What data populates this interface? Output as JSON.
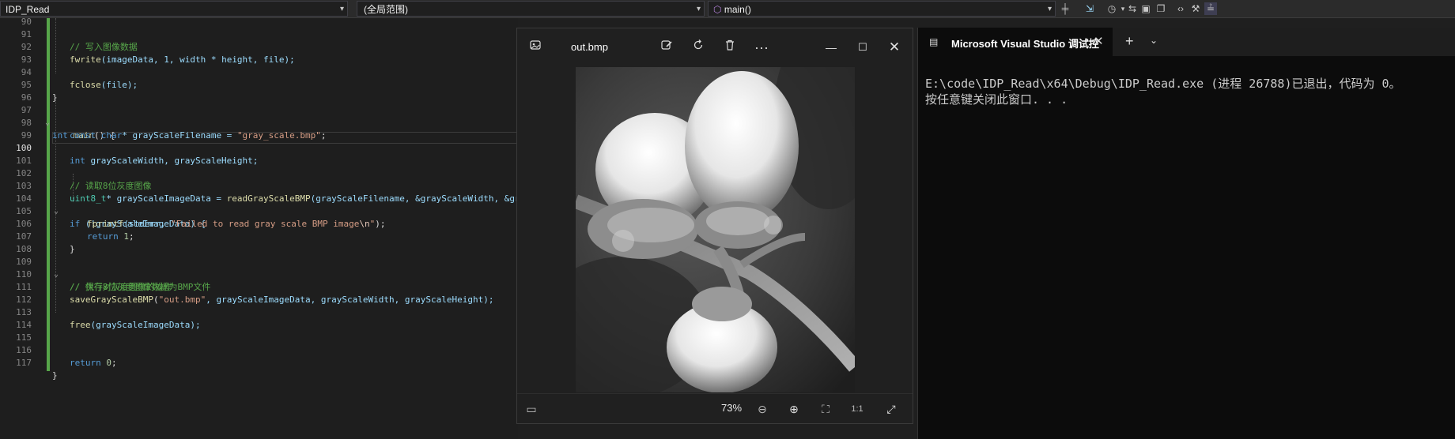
{
  "toolbar": {
    "project": "IDP_Read",
    "scope": "(全局范围)",
    "function": "main()"
  },
  "editor": {
    "current_line": 100,
    "lines": [
      {
        "num": 90
      },
      {
        "num": 91
      },
      {
        "num": 92
      },
      {
        "num": 93
      },
      {
        "num": 94
      },
      {
        "num": 95
      },
      {
        "num": 96
      },
      {
        "num": 97
      },
      {
        "num": 98
      },
      {
        "num": 99
      },
      {
        "num": 100
      },
      {
        "num": 101
      },
      {
        "num": 102
      },
      {
        "num": 103
      },
      {
        "num": 104
      },
      {
        "num": 105
      },
      {
        "num": 106
      },
      {
        "num": 107
      },
      {
        "num": 108
      },
      {
        "num": 109
      },
      {
        "num": 110
      },
      {
        "num": 111
      },
      {
        "num": 112
      },
      {
        "num": 113
      },
      {
        "num": 114
      },
      {
        "num": 115
      },
      {
        "num": 116
      },
      {
        "num": 117
      }
    ],
    "code": {
      "l91": "// 写入图像数据",
      "l92_fn": "fwrite",
      "l92_rest": "(imageData, 1, width * height, file);",
      "l94_fn": "fclose",
      "l94_rest": "(file);",
      "l95": "}",
      "l97_kw": "int",
      "l97_fn": "main",
      "l97_rest": "() {",
      "l98_kw": "const char",
      "l98_var": "* grayScaleFilename = ",
      "l98_str": "\"gray_scale.bmp\"",
      "l98_end": ";",
      "l100_kw": "int",
      "l100_rest": " grayScaleWidth, grayScaleHeight;",
      "l102": "// 读取8位灰度图像",
      "l103_ty": "uint8_t",
      "l103_var": "* grayScaleImageData = ",
      "l103_fn": "readGrayScaleBMP",
      "l103_rest": "(grayScaleFilename, &grayScaleWidth, &gr",
      "l104_kw": "if",
      "l104_rest": " (!grayScaleImageData) {",
      "l105_fn": "fprintf",
      "l105_a": "(stderr, ",
      "l105_str": "\"Failed to read gray scale BMP image",
      "l105_esc": "\\n",
      "l105_str2": "\"",
      "l105_end": ");",
      "l106_kw": "return",
      "l106_num": " 1",
      "l106_end": ";",
      "l107": "}",
      "l109": "// 执行对灰度图像的操作",
      "l110": "// 保存8位灰度图像数据为BMP文件",
      "l111_fn": "saveGrayScaleBMP",
      "l111_a": "(",
      "l111_str": "\"out.bmp\"",
      "l111_rest": ", grayScaleImageData, grayScaleWidth, grayScaleHeight);",
      "l113_fn": "free",
      "l113_rest": "(grayScaleImageData);",
      "l116_kw": "return",
      "l116_num": " 0",
      "l116_end": ";",
      "l117": "}"
    }
  },
  "viewer": {
    "filename": "out.bmp",
    "zoom": "73%",
    "icons": [
      "image-icon",
      "edit-icon",
      "rotate-icon",
      "delete-icon",
      "more-icon",
      "minimize-icon",
      "maximize-icon",
      "close-icon"
    ]
  },
  "console": {
    "tab_title": "Microsoft Visual Studio 调试控",
    "line1": "E:\\code\\IDP_Read\\x64\\Debug\\IDP_Read.exe (进程 26788)已退出，代码为 0。",
    "line2": "按任意键关闭此窗口. . ."
  }
}
